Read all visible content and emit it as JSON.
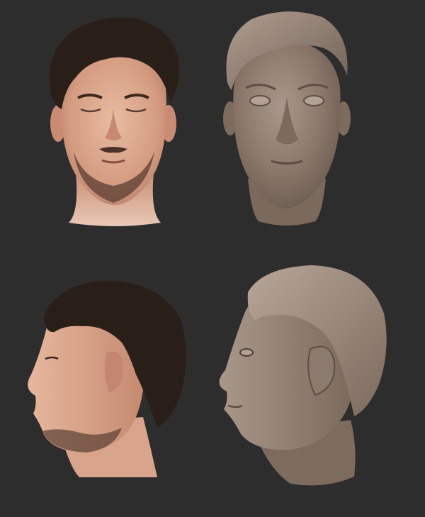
{
  "scene": {
    "background_color": "#2d2d2d",
    "skin_photo_color": "#d9a78c",
    "hair_photo_color": "#2a1e18",
    "sculpt_clay_color": "#8a7769"
  },
  "panels": [
    {
      "view": "front",
      "kind": "photo"
    },
    {
      "view": "front",
      "kind": "sculpt"
    },
    {
      "view": "side",
      "kind": "photo"
    },
    {
      "view": "side",
      "kind": "sculpt"
    }
  ]
}
